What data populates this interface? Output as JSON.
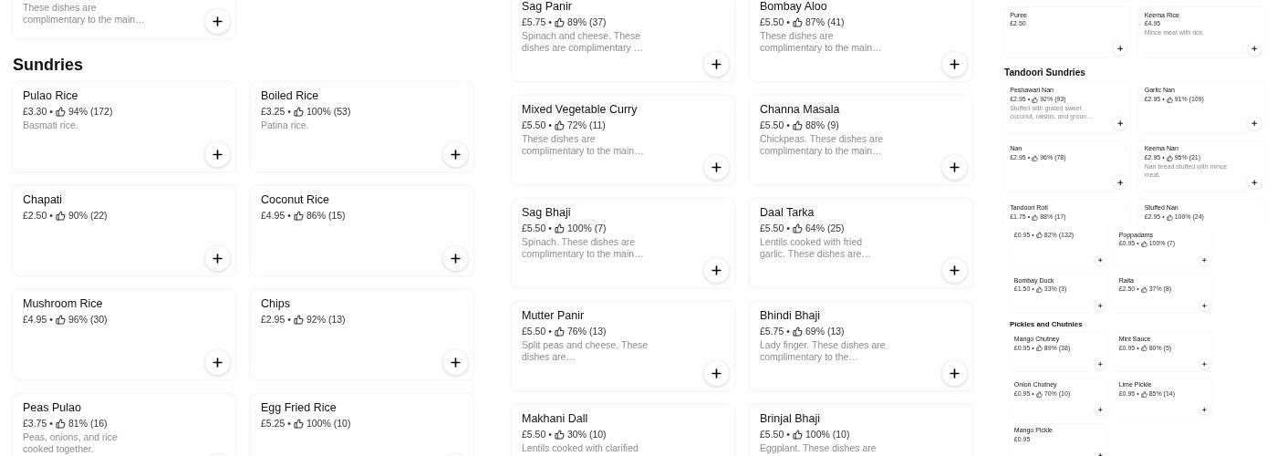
{
  "panels": [
    {
      "kind": "left",
      "sections": [
        {
          "items": [
            {
              "description": "These dishes are complimentary to the main…"
            }
          ]
        },
        {
          "heading": "Sundries",
          "items": [
            {
              "title": "Pulao Rice",
              "price": "£3.30",
              "separator": "•",
              "rating": "94% (172)",
              "description": "Basmati rice."
            },
            {
              "title": "Boiled Rice",
              "price": "£3.25",
              "separator": "•",
              "rating": "100% (53)",
              "description": "Patina rice."
            },
            {
              "title": "Chapati",
              "price": "£2.50",
              "separator": "•",
              "rating": "90% (22)"
            },
            {
              "title": "Coconut Rice",
              "price": "£4.95",
              "separator": "•",
              "rating": "86% (15)"
            },
            {
              "title": "Mushroom Rice",
              "price": "£4.95",
              "separator": "•",
              "rating": "96% (30)"
            },
            {
              "title": "Chips",
              "price": "£2.95",
              "separator": "•",
              "rating": "92% (13)"
            },
            {
              "title": "Peas Pulao",
              "price": "£3.75",
              "separator": "•",
              "rating": "81% (16)",
              "description": "Peas, onions, and rice cooked together."
            },
            {
              "title": "Egg Fried Rice",
              "price": "£5.25",
              "separator": "•",
              "rating": "100% (10)"
            }
          ]
        }
      ]
    },
    {
      "kind": "middle",
      "sections": [
        {
          "items": [
            {
              "title": "Sag Panir",
              "price": "£5.75",
              "separator": "•",
              "rating": "89% (37)",
              "description": "Spinach and cheese. These dishes are complimentary …"
            },
            {
              "title": "Bombay Aloo",
              "price": "£5.50",
              "separator": "•",
              "rating": "87% (41)",
              "description": "These dishes are complimentary to the main…"
            },
            {
              "title": "Mixed Vegetable Curry",
              "price": "£5.50",
              "separator": "•",
              "rating": "72% (11)",
              "description": "These dishes are complimentary to the main…"
            },
            {
              "title": "Channa  Masala",
              "price": "£5.50",
              "separator": "•",
              "rating": "88% (9)",
              "description": "Chickpeas. These dishes are complimentary to the main…"
            },
            {
              "title": "Sag Bhaji",
              "price": "£5.50",
              "separator": "•",
              "rating": "100% (7)",
              "description": "Spinach. These dishes are complimentary to the main…"
            },
            {
              "title": "Daal Tarka",
              "price": "£5.50",
              "separator": "•",
              "rating": "64% (25)",
              "description": "Lentils cooked with fried garlic. These dishes are…"
            },
            {
              "title": "Mutter Panir",
              "price": "£5.50",
              "separator": "•",
              "rating": "76% (13)",
              "description": "Split peas and cheese. These dishes are…"
            },
            {
              "title": "Bhindi Bhaji",
              "price": "£5.75",
              "separator": "•",
              "rating": "69% (13)",
              "description": "Lady finger. These dishes are complimentary to the…"
            },
            {
              "title": "Makhani Dall",
              "price": "£5.50",
              "separator": "•",
              "rating": "30% (10)",
              "description": "Lentils cooked with clarified"
            },
            {
              "title": "Brinjal Bhaji",
              "price": "£5.50",
              "separator": "•",
              "rating": "100% (10)",
              "description": "Eggplant. These dishes are"
            }
          ]
        }
      ]
    },
    {
      "kind": "mini",
      "sections": [
        {
          "items": [
            {
              "title": "Puree",
              "price": "£2.50"
            },
            {
              "title": "Keema Rice",
              "price": "£4.95",
              "description": "Mince meat with rice."
            }
          ]
        },
        {
          "heading": "Tandoori Sundries",
          "items": [
            {
              "title": "Peshawari Nan",
              "price": "£2.95",
              "separator": "•",
              "rating": "92% (93)",
              "description": "Stuffed with grated sweet coconut, raisins, and groun…"
            },
            {
              "title": "Garlic Nan",
              "price": "£2.95",
              "separator": "•",
              "rating": "91% (109)"
            },
            {
              "title": "Nan",
              "price": "£2.95",
              "separator": "•",
              "rating": "96% (78)"
            },
            {
              "title": "Keema Nan",
              "price": "£2.95",
              "separator": "•",
              "rating": "95% (21)",
              "description": "Nan bread stuffed with mince meat."
            },
            {
              "title": "Tandoori Roti",
              "price": "£1.75",
              "separator": "•",
              "rating": "88% (17)"
            },
            {
              "title": "Stuffed Nan",
              "price": "£2.95",
              "separator": "•",
              "rating": "100% (24)"
            }
          ]
        }
      ]
    },
    {
      "kind": "micro",
      "sections": [
        {
          "items": [
            {
              "price": "£0.95",
              "separator": "•",
              "rating": "82% (132)"
            },
            {
              "title": "Poppadams",
              "price": "£0.95",
              "separator": "•",
              "rating": "100% (7)"
            },
            {
              "title": "Bombay Duck",
              "price": "£1.50",
              "separator": "•",
              "rating": "33% (3)"
            },
            {
              "title": "Raita",
              "price": "£2.50",
              "separator": "•",
              "rating": "37% (8)"
            }
          ]
        },
        {
          "heading": "Pickles and Chutnies",
          "items": [
            {
              "title": "Mango Chutney",
              "price": "£0.95",
              "separator": "•",
              "rating": "89% (38)"
            },
            {
              "title": "Mint Sauce",
              "price": "£0.95",
              "separator": "•",
              "rating": "80% (5)"
            },
            {
              "title": "Onion Chutney",
              "price": "£0.95",
              "separator": "•",
              "rating": "70% (10)"
            },
            {
              "title": "Lime Pickle",
              "price": "£0.95",
              "separator": "•",
              "rating": "85% (14)"
            },
            {
              "title": "Mango Pickle",
              "price": "£0.95"
            }
          ]
        }
      ]
    }
  ]
}
